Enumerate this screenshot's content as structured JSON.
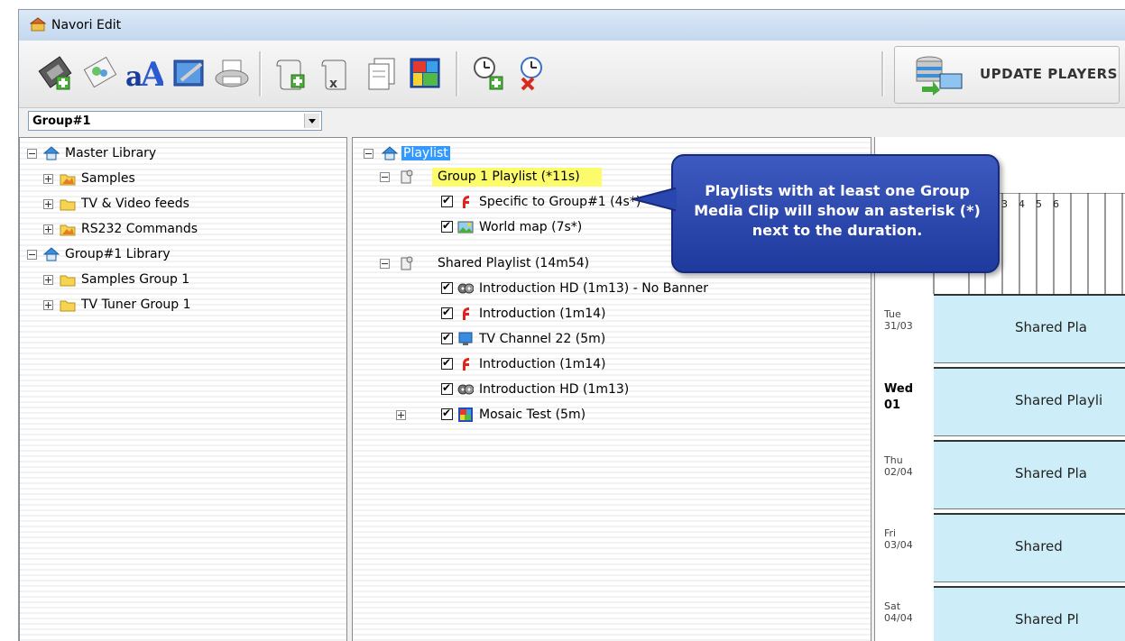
{
  "window": {
    "title": "Navori Edit"
  },
  "toolbar": {
    "buttons": [
      {
        "icon": "film-add-icon"
      },
      {
        "icon": "photo-add-icon"
      },
      {
        "icon": "text-icon"
      },
      {
        "icon": "image-edit-icon"
      },
      {
        "icon": "printer-icon"
      },
      {
        "icon": "playlist-add-icon"
      },
      {
        "icon": "playlist-delete-icon"
      },
      {
        "icon": "document-copy-icon"
      },
      {
        "icon": "mosaic-icon"
      },
      {
        "icon": "schedule-add-icon"
      },
      {
        "icon": "schedule-delete-icon"
      }
    ],
    "update_players_label": "Update Players"
  },
  "group_select": {
    "value": "Group#1"
  },
  "library_tree": [
    {
      "label": "Master Library",
      "icon": "library-home-icon",
      "level": 0,
      "expander": "minus"
    },
    {
      "label": "Samples",
      "icon": "folder-shared-icon",
      "level": 1,
      "expander": "plus"
    },
    {
      "label": "TV & Video feeds",
      "icon": "folder-icon",
      "level": 1,
      "expander": "plus"
    },
    {
      "label": "RS232 Commands",
      "icon": "folder-shared-icon",
      "level": 1,
      "expander": "plus"
    },
    {
      "label": "Group#1 Library",
      "icon": "library-home-icon",
      "level": 0,
      "expander": "minus"
    },
    {
      "label": "Samples Group 1",
      "icon": "folder-icon",
      "level": 1,
      "expander": "plus"
    },
    {
      "label": "TV Tuner Group 1",
      "icon": "folder-icon",
      "level": 1,
      "expander": "plus"
    }
  ],
  "playlist_tree": {
    "root": "Playlist",
    "group_playlist": "Group 1 Playlist (*11s)",
    "group_items": [
      {
        "label": "Specific to Group#1 (4s*)",
        "icon": "flash-icon"
      },
      {
        "label": "World map (7s*)",
        "icon": "image-icon"
      }
    ],
    "shared_playlist": "Shared Playlist (14m54)",
    "shared_items": [
      {
        "label": "Introduction HD (1m13) - No Banner",
        "icon": "film-reel-icon"
      },
      {
        "label": "Introduction (1m14)",
        "icon": "flash-icon"
      },
      {
        "label": "TV Channel 22 (5m)",
        "icon": "tv-monitor-icon"
      },
      {
        "label": "Introduction (1m14)",
        "icon": "flash-icon"
      },
      {
        "label": "Introduction HD (1m13)",
        "icon": "film-reel-icon"
      },
      {
        "label": "Mosaic Test (5m)",
        "icon": "mosaic-icon"
      }
    ]
  },
  "schedule": {
    "hours": [
      "3",
      "4",
      "5",
      "6"
    ],
    "days": [
      {
        "day": "Tue",
        "date": "31/03",
        "block": "Shared Pla",
        "current": false
      },
      {
        "day": "Wed",
        "date": "01",
        "block": "Shared Playli",
        "current": true
      },
      {
        "day": "Thu",
        "date": "02/04",
        "block": "Shared Pla",
        "current": false
      },
      {
        "day": "Fri",
        "date": "03/04",
        "block": "Shared",
        "current": false
      },
      {
        "day": "Sat",
        "date": "04/04",
        "block": "Shared Pl",
        "current": false
      }
    ]
  },
  "callout": {
    "text": "Playlists with at least one Group Media Clip will show an asterisk (*) next to the duration."
  },
  "colors": {
    "callout_bg": "#2a47b0",
    "highlight": "#fbfb6c",
    "schedule_block": "#cdeef8",
    "selection": "#3399ff"
  }
}
